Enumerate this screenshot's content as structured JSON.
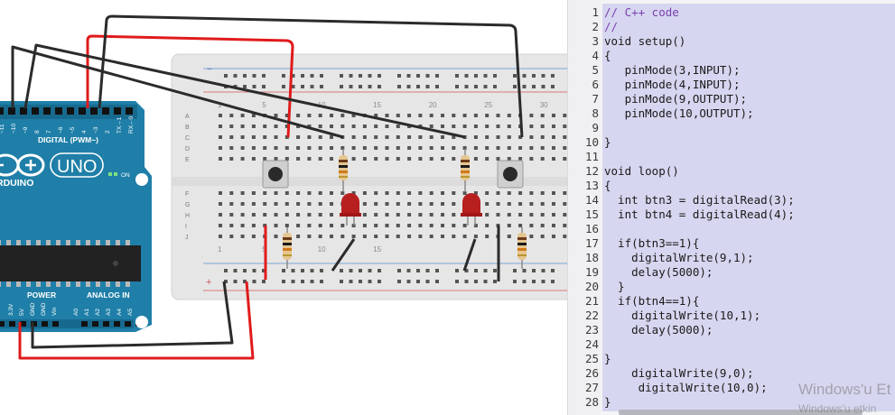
{
  "code_editor": {
    "line_numbers": [
      "1",
      "2",
      "3",
      "4",
      "5",
      "6",
      "7",
      "8",
      "9",
      "10",
      "11",
      "12",
      "13",
      "14",
      "15",
      "16",
      "17",
      "18",
      "19",
      "20",
      "21",
      "22",
      "23",
      "24",
      "25",
      "26",
      "27",
      "28"
    ],
    "lines": [
      "// C++ code",
      "//",
      "void setup()",
      "{",
      "   pinMode(3,INPUT);",
      "   pinMode(4,INPUT);",
      "   pinMode(9,OUTPUT);",
      "   pinMode(10,OUTPUT);",
      "",
      "}",
      "",
      "void loop()",
      "{",
      "  int btn3 = digitalRead(3);",
      "  int btn4 = digitalRead(4);",
      "",
      "  if(btn3==1){",
      "    digitalWrite(9,1);",
      "    delay(5000);",
      "  }",
      "  if(btn4==1){",
      "    digitalWrite(10,1);",
      "    delay(5000);",
      "",
      "}",
      "    digitalWrite(9,0);",
      "     digitalWrite(10,0);",
      "}"
    ]
  },
  "watermark": {
    "line1": "Windows'u Et",
    "line2": "Windows'u etkin"
  },
  "breadboard": {
    "column_numbers": [
      "1",
      "5",
      "10",
      "15",
      "20",
      "25",
      "30"
    ],
    "bottom_column_numbers": [
      "1",
      "5",
      "10",
      "15"
    ],
    "row_letters_top": [
      "A",
      "B",
      "C",
      "D",
      "E"
    ],
    "row_letters_bottom": [
      "F",
      "G",
      "H",
      "I",
      "J"
    ],
    "rail_minus": "−",
    "rail_plus": "+"
  },
  "arduino": {
    "model": "UNO",
    "brand": "RDUINO",
    "digital_label": "DIGITAL (PWM~)",
    "on_label": "ON",
    "power_label": "POWER",
    "analog_label": "ANALOG IN",
    "top_pins": [
      "~11",
      "~10",
      "~9",
      "8",
      "7",
      "~6",
      "~5",
      "4",
      "~3",
      "2",
      "TX→1",
      "RX←0"
    ],
    "power_pins": [
      "3.3V",
      "5V",
      "GND",
      "GND",
      "Vin"
    ],
    "analog_pins": [
      "A0",
      "A1",
      "A2",
      "A3",
      "A4",
      "A5"
    ]
  },
  "colors": {
    "wire_red": "#e01b1b",
    "wire_black": "#2b2b2b",
    "arduino_blue": "#1f7fa8",
    "breadboard": "#e7e7e7",
    "code_highlight": "#d6d6f0",
    "led_red": "#b81f1f"
  }
}
